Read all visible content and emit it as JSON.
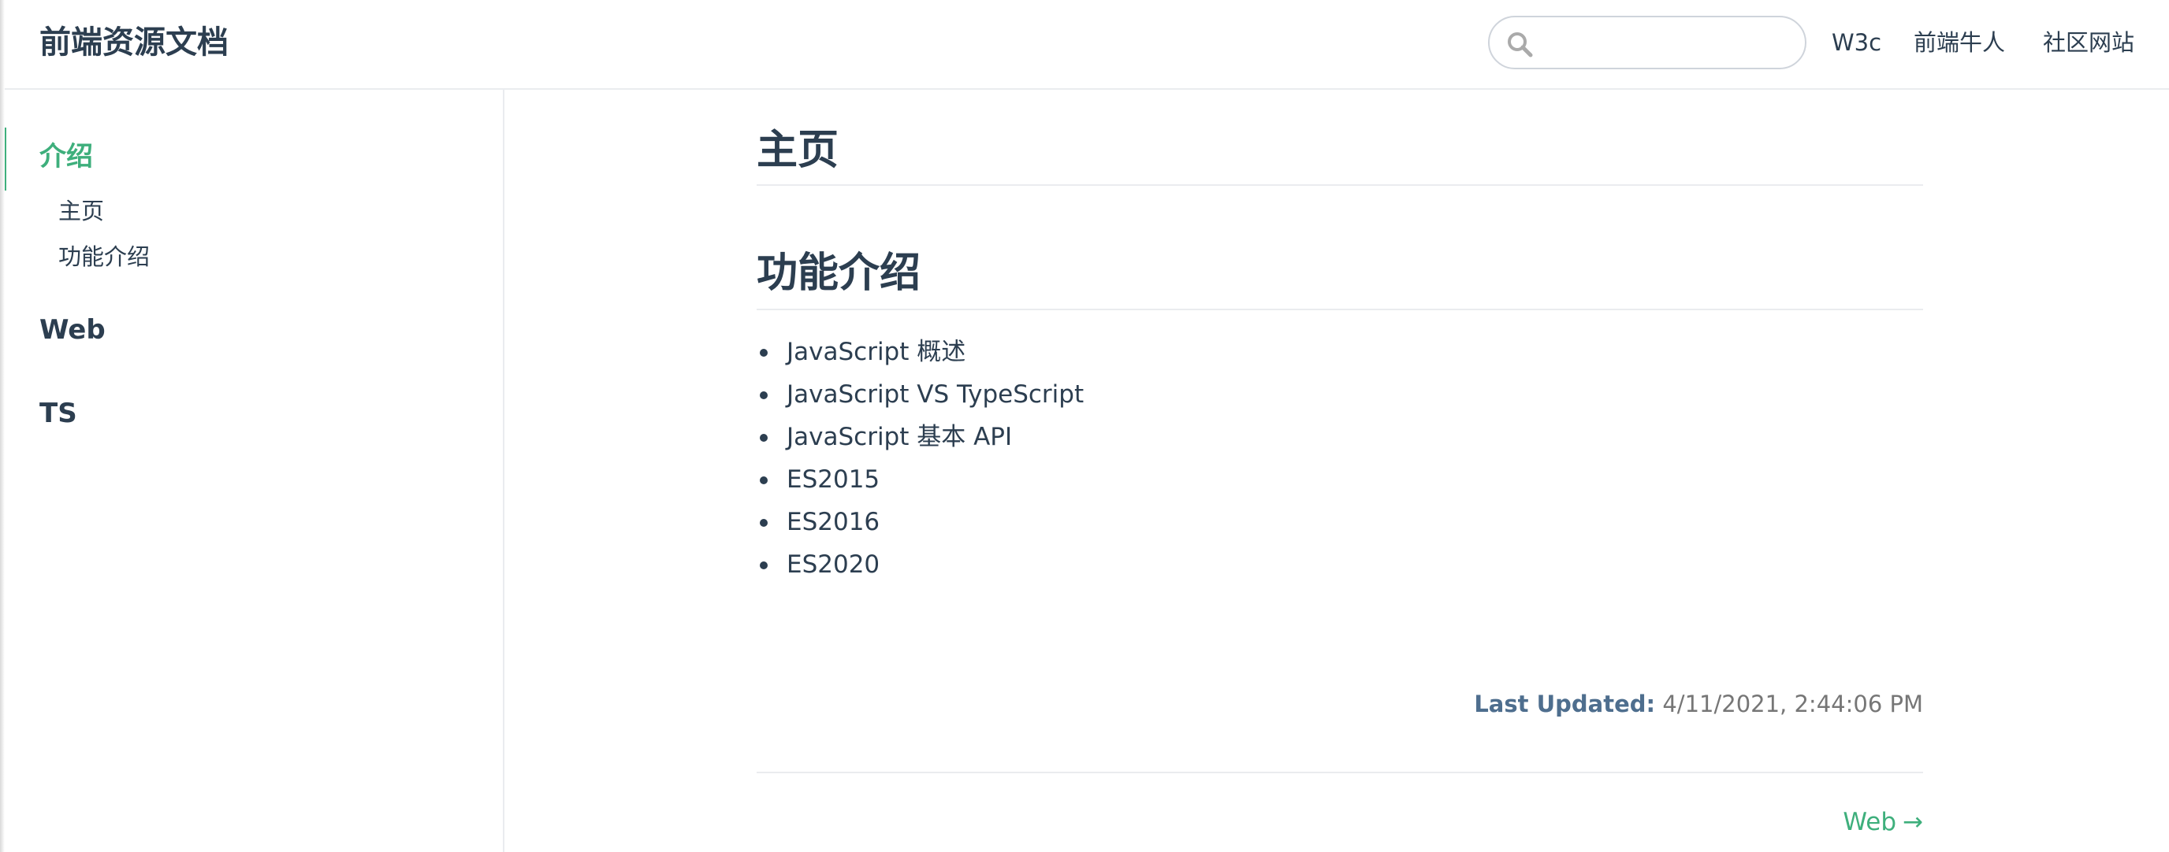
{
  "navbar": {
    "site_name": "前端资源文档",
    "search": {
      "value": "",
      "placeholder": ""
    },
    "links": [
      "W3c",
      "前端牛人",
      "社区网站"
    ]
  },
  "sidebar": {
    "groups": [
      {
        "title": "介绍",
        "active": true,
        "items": [
          "主页",
          "功能介绍"
        ]
      },
      {
        "title": "Web",
        "active": false,
        "items": []
      },
      {
        "title": "TS",
        "active": false,
        "items": []
      }
    ]
  },
  "content": {
    "h1": "主页",
    "h2": "功能介绍",
    "features": [
      "JavaScript 概述",
      "JavaScript VS TypeScript",
      "JavaScript 基本 API",
      "ES2015",
      "ES2016",
      "ES2020"
    ],
    "last_updated_label": "Last Updated:",
    "last_updated_time": "4/11/2021, 2:44:06 PM",
    "next_label": "Web",
    "next_arrow": "→"
  },
  "colors": {
    "accent": "#3eaf7c",
    "text": "#2c3e50",
    "border": "#eaecef"
  },
  "icons": [
    "search-icon"
  ]
}
